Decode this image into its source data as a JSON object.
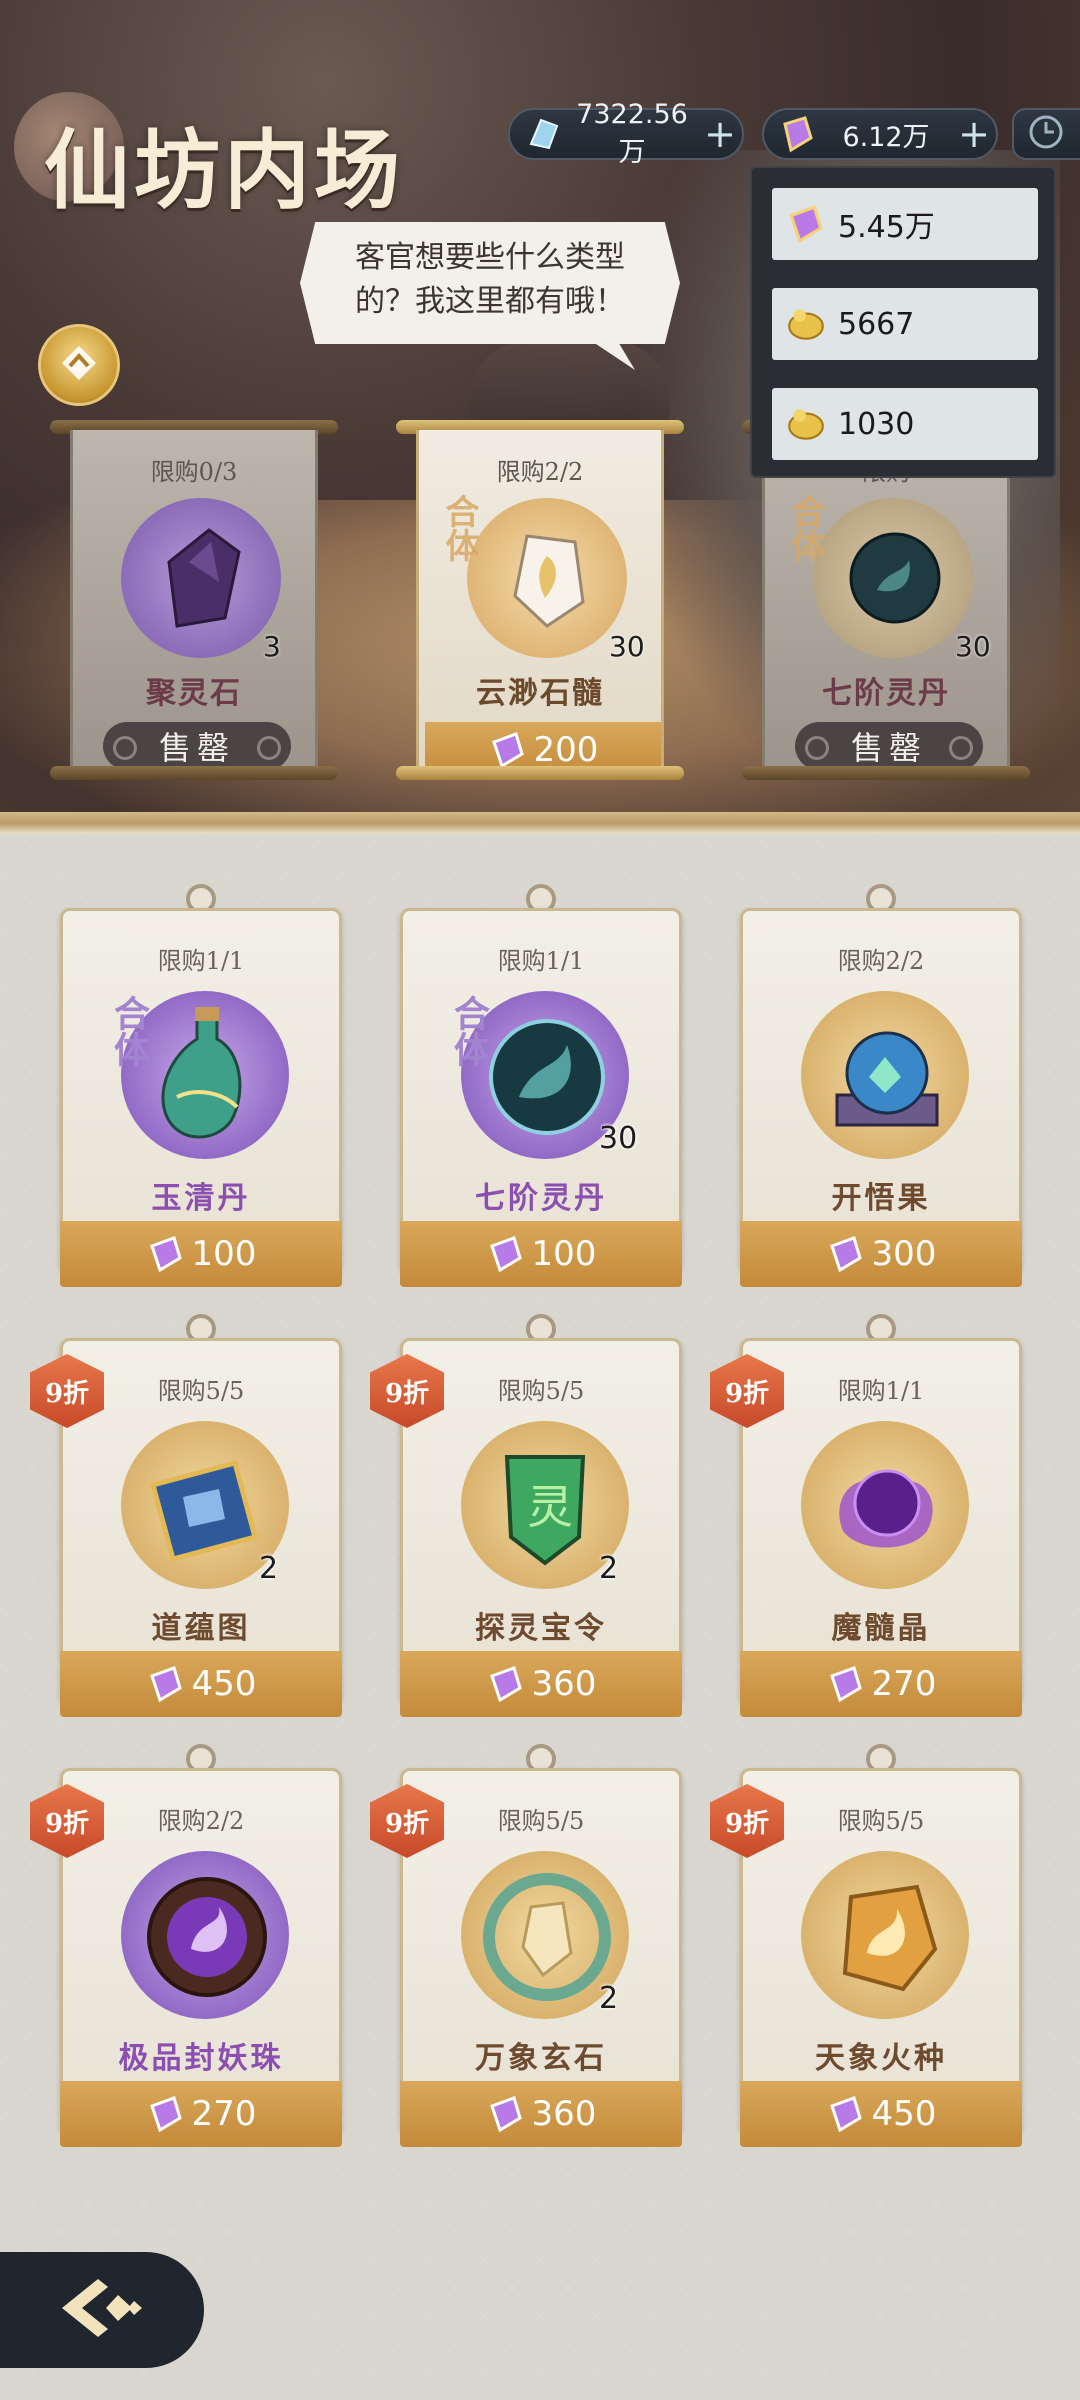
{
  "header": {
    "title": "仙坊内场",
    "currency_spirit_stone": "7322.56万",
    "currency_crystal": "6.12万",
    "plus_label": "+"
  },
  "popup": {
    "rows": [
      {
        "value": "5.45万",
        "icon": "purple-crystal-icon"
      },
      {
        "value": "5667",
        "icon": "gold-coin-icon"
      },
      {
        "value": "1030",
        "icon": "gold-coin-icon"
      }
    ]
  },
  "bubble": {
    "line1": "客官想要些什么类型",
    "line2": "的？我这里都有哦！"
  },
  "top_items": [
    {
      "limit": "限购0/3",
      "name": "聚灵石",
      "qty": "3",
      "tag": "",
      "status": "售罄",
      "price": ""
    },
    {
      "limit": "限购2/2",
      "name": "云渺石髓",
      "qty": "30",
      "tag": "合体",
      "status": "",
      "price": "200"
    },
    {
      "limit": "限购",
      "name": "七阶灵丹",
      "qty": "30",
      "tag": "合体",
      "status": "售罄",
      "price": ""
    }
  ],
  "shop_items": [
    {
      "limit": "限购1/1",
      "name": "玉清丹",
      "qty": "",
      "tag": "合体",
      "price": "100",
      "discount": "",
      "color": "purple"
    },
    {
      "limit": "限购1/1",
      "name": "七阶灵丹",
      "qty": "30",
      "tag": "合体",
      "price": "100",
      "discount": "",
      "color": "purple"
    },
    {
      "limit": "限购2/2",
      "name": "开悟果",
      "qty": "",
      "tag": "",
      "price": "300",
      "discount": "",
      "color": "brown"
    },
    {
      "limit": "限购5/5",
      "name": "道蕴图",
      "qty": "2",
      "tag": "",
      "price": "450",
      "discount": "9折",
      "color": "brown"
    },
    {
      "limit": "限购5/5",
      "name": "探灵宝令",
      "qty": "2",
      "tag": "",
      "price": "360",
      "discount": "9折",
      "color": "brown"
    },
    {
      "limit": "限购1/1",
      "name": "魔髓晶",
      "qty": "",
      "tag": "",
      "price": "270",
      "discount": "9折",
      "color": "brown"
    },
    {
      "limit": "限购2/2",
      "name": "极品封妖珠",
      "qty": "",
      "tag": "",
      "price": "270",
      "discount": "9折",
      "color": "purple"
    },
    {
      "limit": "限购5/5",
      "name": "万象玄石",
      "qty": "2",
      "tag": "",
      "price": "360",
      "discount": "9折",
      "color": "brown"
    },
    {
      "limit": "限购5/5",
      "name": "天象火种",
      "qty": "",
      "tag": "",
      "price": "450",
      "discount": "9折",
      "color": "brown"
    }
  ],
  "colors": {
    "accent_gold": "#c48a3a",
    "purple_text": "#8a4fb0",
    "discount_badge": "#d85a34"
  }
}
